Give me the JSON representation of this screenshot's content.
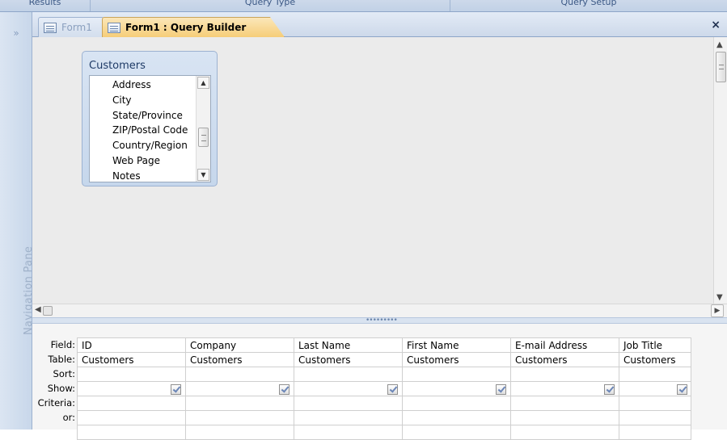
{
  "ribbon": {
    "groups": [
      "Results",
      "Query Type",
      "Query Setup"
    ]
  },
  "nav_pane": {
    "label": "Navigation Pane",
    "toggle_glyph": "»"
  },
  "tabs": [
    {
      "label": "Form1",
      "active": false
    },
    {
      "label": "Form1 : Query Builder",
      "active": true
    }
  ],
  "close_glyph": "×",
  "table": {
    "name": "Customers",
    "fields": [
      "Address",
      "City",
      "State/Province",
      "ZIP/Postal Code",
      "Country/Region",
      "Web Page",
      "Notes"
    ]
  },
  "grid": {
    "row_labels": [
      "Field:",
      "Table:",
      "Sort:",
      "Show:",
      "Criteria:",
      "or:"
    ],
    "columns": [
      {
        "field": "ID",
        "table": "Customers",
        "show": true
      },
      {
        "field": "Company",
        "table": "Customers",
        "show": true
      },
      {
        "field": "Last Name",
        "table": "Customers",
        "show": true
      },
      {
        "field": "First Name",
        "table": "Customers",
        "show": true
      },
      {
        "field": "E-mail Address",
        "table": "Customers",
        "show": true
      },
      {
        "field": "Job Title",
        "table": "Customers",
        "show": true
      }
    ]
  },
  "colors": {
    "active_tab": "#f6cd78",
    "design_bg": "#ebebeb",
    "nav_pane": "#c8d7ea"
  }
}
